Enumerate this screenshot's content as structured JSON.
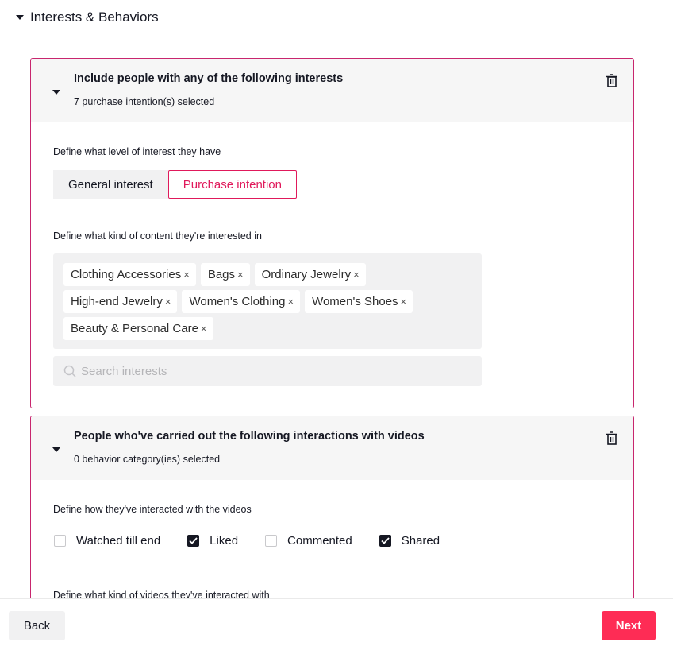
{
  "section": {
    "title": "Interests & Behaviors"
  },
  "interests_card": {
    "title": "Include people with any of the following interests",
    "subtitle": "7 purchase intention(s) selected",
    "level_label": "Define what level of interest they have",
    "level_options": [
      "General interest",
      "Purchase intention"
    ],
    "level_selected": "Purchase intention",
    "content_label": "Define what kind of content they're interested in",
    "tags": [
      "Clothing Accessories",
      "Bags",
      "Ordinary Jewelry",
      "High-end Jewelry",
      "Women's Clothing",
      "Women's Shoes",
      "Beauty & Personal Care"
    ],
    "tag_remove_glyph": "×",
    "search_placeholder": "Search interests"
  },
  "behavior_card": {
    "title": "People who've carried out the following interactions with videos",
    "subtitle": "0 behavior category(ies) selected",
    "interaction_label": "Define how they've interacted with the videos",
    "interactions": [
      {
        "label": "Watched till end",
        "checked": false
      },
      {
        "label": "Liked",
        "checked": true
      },
      {
        "label": "Commented",
        "checked": false
      },
      {
        "label": "Shared",
        "checked": true
      }
    ],
    "videos_label": "Define what kind of videos they've interacted with"
  },
  "footer": {
    "back_label": "Back",
    "next_label": "Next"
  },
  "colors": {
    "accent": "#fe2c55",
    "card_border": "#c8266e",
    "selected_text": "#e0195b",
    "muted_bg": "#f1f1f2"
  },
  "icons": {
    "collapse": "caret-down-icon",
    "delete": "trash-icon",
    "search": "search-icon",
    "check": "check-icon"
  }
}
